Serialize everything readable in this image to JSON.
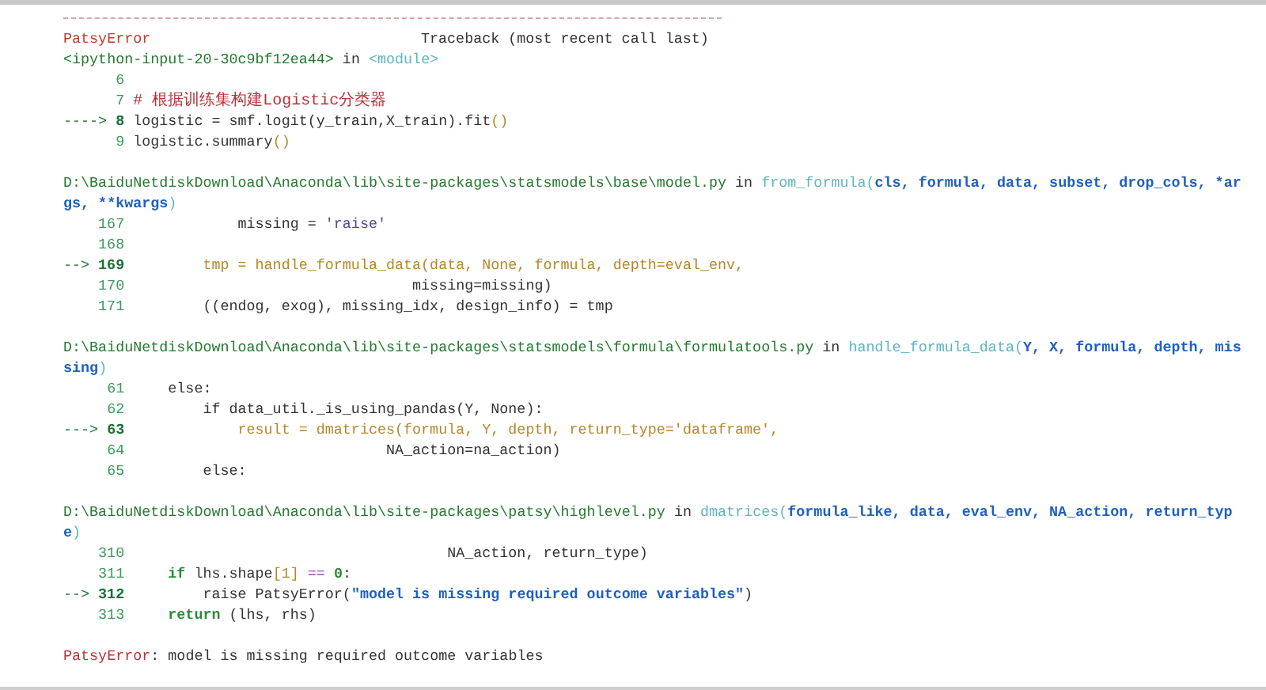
{
  "error_header": {
    "name": "PatsyError",
    "traceback_label": "Traceback (most recent call last)"
  },
  "frames": [
    {
      "location": [
        {
          "text": "<ipython-input-20-30c9bf12ea44>",
          "kind": "path"
        },
        {
          "text": " in ",
          "kind": "plain"
        },
        {
          "text": "<module>",
          "kind": "func"
        }
      ],
      "lines": [
        {
          "number": "6",
          "current": false
        },
        {
          "number": "7",
          "current": false,
          "code": [
            {
              "text": "# 根据训练集构建Logistic分类器",
              "kind": "comment"
            }
          ]
        },
        {
          "arrow": "---->",
          "number": "8",
          "current": true,
          "code": [
            {
              "text": "logistic = smf.logit(y_train,X_train).fit",
              "kind": "plain"
            },
            {
              "text": "()",
              "kind": "highlight"
            }
          ]
        },
        {
          "number": "9",
          "current": false,
          "code": [
            {
              "text": "logistic.summary",
              "kind": "plain"
            },
            {
              "text": "()",
              "kind": "highlight"
            }
          ]
        }
      ]
    },
    {
      "location": [
        {
          "text": "D:\\BaiduNetdiskDownload\\Anaconda\\lib\\site-packages\\statsmodels\\base\\model.py",
          "kind": "path"
        },
        {
          "text": " in ",
          "kind": "plain"
        },
        {
          "text": "from_formula(",
          "kind": "func"
        },
        {
          "text": "cls, formula, data, subset, drop_cols, *args, **kwargs",
          "kind": "args"
        },
        {
          "text": ")",
          "kind": "func"
        }
      ],
      "lines": [
        {
          "number": "167",
          "current": false,
          "code": [
            {
              "text": "            missing = ",
              "kind": "plain"
            },
            {
              "text": "'raise'",
              "kind": "string"
            }
          ]
        },
        {
          "number": "168",
          "current": false
        },
        {
          "arrow": "-->",
          "number": "169",
          "current": true,
          "code": [
            {
              "text": "        tmp = handle_formula_data(data, None, formula, depth=eval_env,",
              "kind": "highlight"
            }
          ]
        },
        {
          "number": "170",
          "current": false,
          "code": [
            {
              "text": "                                missing=missing)",
              "kind": "plain"
            }
          ]
        },
        {
          "number": "171",
          "current": false,
          "code": [
            {
              "text": "        ((endog, exog), missing_idx, design_info) = tmp",
              "kind": "plain"
            }
          ]
        }
      ]
    },
    {
      "location": [
        {
          "text": "D:\\BaiduNetdiskDownload\\Anaconda\\lib\\site-packages\\statsmodels\\formula\\formulatools.py",
          "kind": "path"
        },
        {
          "text": " in ",
          "kind": "plain"
        },
        {
          "text": "handle_formula_data(",
          "kind": "func"
        },
        {
          "text": "Y, X, formula, depth, missing",
          "kind": "args"
        },
        {
          "text": ")",
          "kind": "func"
        }
      ],
      "lines": [
        {
          "number": "61",
          "current": false,
          "code": [
            {
              "text": "    else:",
              "kind": "plain"
            }
          ]
        },
        {
          "number": "62",
          "current": false,
          "code": [
            {
              "text": "        if data_util._is_using_pandas(Y, None):",
              "kind": "plain"
            }
          ]
        },
        {
          "arrow": "--->",
          "number": "63",
          "current": true,
          "code": [
            {
              "text": "            result = dmatrices(formula, Y, depth, return_type='dataframe',",
              "kind": "highlight"
            }
          ]
        },
        {
          "number": "64",
          "current": false,
          "code": [
            {
              "text": "                             NA_action=na_action)",
              "kind": "plain"
            }
          ]
        },
        {
          "number": "65",
          "current": false,
          "code": [
            {
              "text": "        else:",
              "kind": "plain"
            }
          ]
        }
      ]
    },
    {
      "location": [
        {
          "text": "D:\\BaiduNetdiskDownload\\Anaconda\\lib\\site-packages\\patsy\\highlevel.py",
          "kind": "path"
        },
        {
          "text": " in ",
          "kind": "plain"
        },
        {
          "text": "dmatrices(",
          "kind": "func"
        },
        {
          "text": "formula_like, data, eval_env, NA_action, return_type",
          "kind": "args"
        },
        {
          "text": ")",
          "kind": "func"
        }
      ],
      "lines": [
        {
          "number": "310",
          "current": false,
          "code": [
            {
              "text": "                                    NA_action, return_type)",
              "kind": "plain"
            }
          ]
        },
        {
          "number": "311",
          "current": false,
          "code": [
            {
              "text": "    if",
              "kind": "keyword"
            },
            {
              "text": " lhs.shape",
              "kind": "plain"
            },
            {
              "text": "[1]",
              "kind": "highlight"
            },
            {
              "text": " == ",
              "kind": "operator"
            },
            {
              "text": "0",
              "kind": "keyword"
            },
            {
              "text": ":",
              "kind": "plain"
            }
          ]
        },
        {
          "arrow": "-->",
          "number": "312",
          "current": true,
          "code": [
            {
              "text": "        raise PatsyError(",
              "kind": "plain"
            },
            {
              "text": "\"model is missing required outcome variables\"",
              "kind": "args"
            },
            {
              "text": ")",
              "kind": "plain"
            }
          ]
        },
        {
          "number": "313",
          "current": false,
          "code": [
            {
              "text": "    return",
              "kind": "keyword"
            },
            {
              "text": " (lhs, rhs)",
              "kind": "plain"
            }
          ]
        }
      ]
    }
  ],
  "error_message": {
    "name": "PatsyError",
    "text": ": model is missing required outcome variables"
  }
}
